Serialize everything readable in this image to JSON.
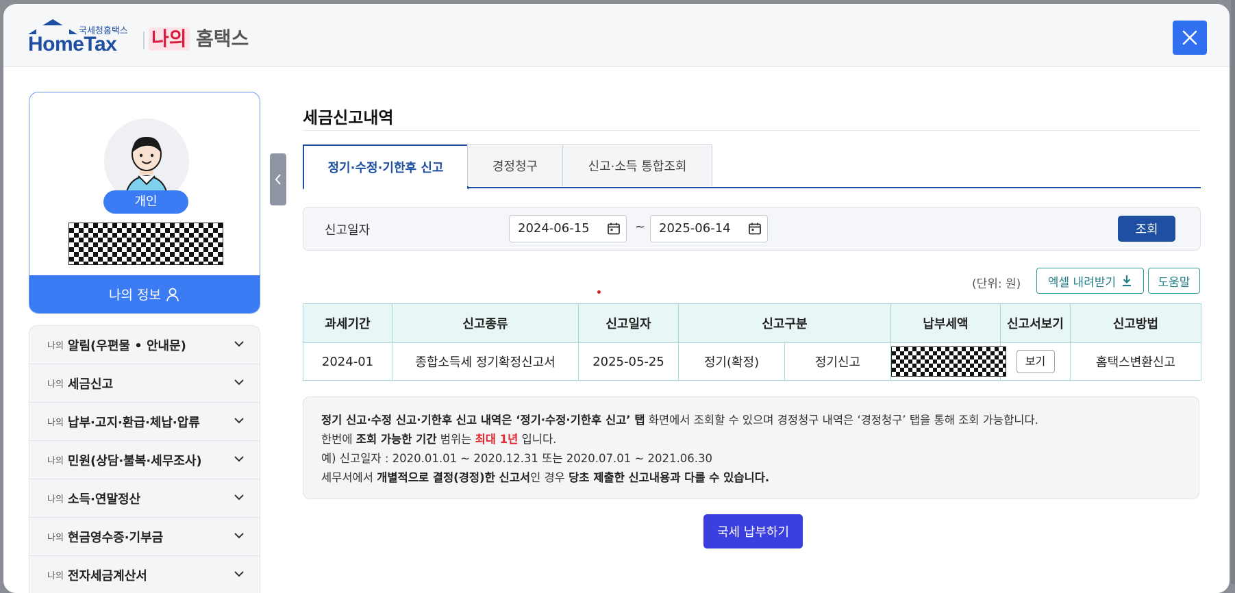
{
  "header": {
    "logo_small": "국세청홈택스",
    "logo_big": "HomeTax",
    "my_label": "나의",
    "hometax_kr": "홈택스"
  },
  "profile": {
    "badge": "개인",
    "my_info_label": "나의 정보"
  },
  "menu": {
    "prefix": "나의",
    "items": [
      {
        "label": "알림(우편물 • 안내문)"
      },
      {
        "label": "세금신고"
      },
      {
        "label": "납부·고지·환급·체납·압류"
      },
      {
        "label": "민원(상담·불복·세무조사)"
      },
      {
        "label": "소득·연말정산"
      },
      {
        "label": "현금영수증·기부금"
      },
      {
        "label": "전자세금계산서"
      }
    ]
  },
  "main": {
    "title": "세금신고내역",
    "tabs": [
      {
        "label": "정기·수정·기한후 신고"
      },
      {
        "label": "경정청구"
      },
      {
        "label": "신고·소득 통합조회"
      }
    ],
    "search": {
      "label": "신고일자",
      "from": "2024-06-15",
      "tilde": "~",
      "to": "2025-06-14",
      "button": "조회"
    },
    "unit": "(단위: 원)",
    "excel_button": "엑셀 내려받기",
    "help_button": "도움말",
    "table": {
      "headers": [
        "과세기간",
        "신고종류",
        "신고일자",
        "신고구분",
        "납부세액",
        "신고서보기",
        "신고방법"
      ],
      "rows": [
        {
          "period": "2024-01",
          "type": "종합소득세 정기확정신고서",
          "date": "2025-05-25",
          "category1": "정기(확정)",
          "category2": "정기신고",
          "view": "보기",
          "method": "홈택스변환신고"
        }
      ]
    },
    "notice": {
      "l1_b1": "정기 신고·수정 신고·기한후 신고 내역은 ‘정기·수정·기한후 신고’ 탭",
      "l1_t1": " 화면에서 조회할 수 있으며 경정청구 내역은  ‘경정청구’ 탭을 통해 조회 가능합니다.",
      "l2_t1": "한번에 ",
      "l2_b1": "조회 가능한 기간",
      "l2_t2": " 범위는 ",
      "l2_r1": "최대 1년",
      "l2_t3": " 입니다.",
      "l3": "예) 신고일자 : 2020.01.01 ~ 2020.12.31 또는 2020.07.01 ~ 2021.06.30",
      "l4_t1": "세무서에서 ",
      "l4_b1": "개별적으로 결정(경정)한 신고서",
      "l4_t2": "인 경우 ",
      "l4_b2": "당초 제출한 신고내용과 다를 수 있습니다."
    },
    "pay_button": "국세 납부하기"
  }
}
